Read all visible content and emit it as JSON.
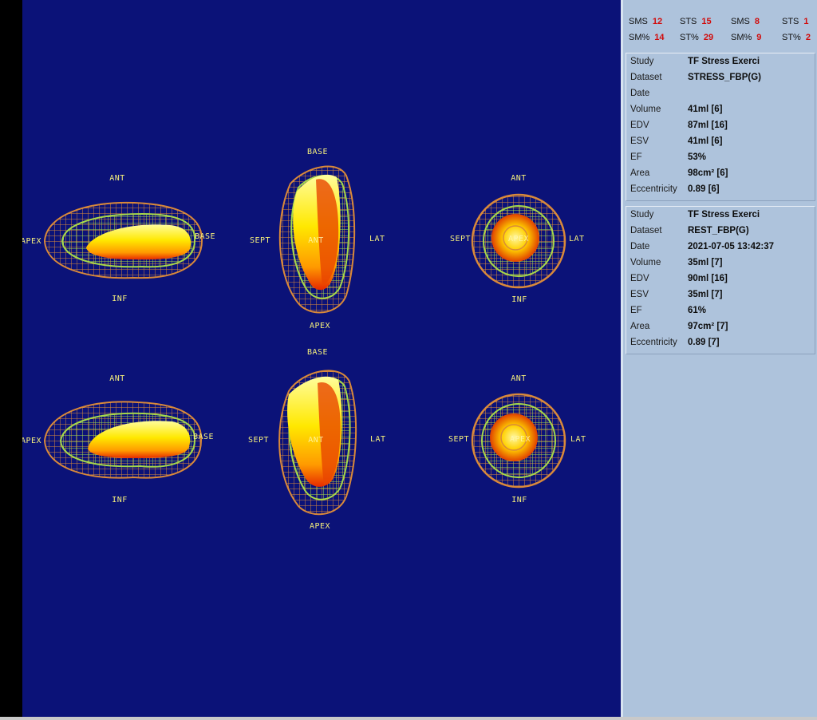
{
  "views": {
    "stress": {
      "horizontal": {
        "ant": "ANT",
        "inf": "INF",
        "apex": "APEX",
        "base": "BASE"
      },
      "vertical": {
        "base": "BASE",
        "sept": "SEPT",
        "ant": "ANT",
        "lat": "LAT",
        "apex": "APEX"
      },
      "short_axis": {
        "ant": "ANT",
        "sept": "SEPT",
        "apex": "APEX",
        "lat": "LAT",
        "inf": "INF"
      }
    },
    "rest": {
      "horizontal": {
        "ant": "ANT",
        "inf": "INF",
        "apex": "APEX",
        "base": "BASE"
      },
      "vertical": {
        "base": "BASE",
        "sept": "SEPT",
        "ant": "ANT",
        "lat": "LAT",
        "apex": "APEX"
      },
      "short_axis": {
        "ant": "ANT",
        "sept": "SEPT",
        "apex": "APEX",
        "lat": "LAT",
        "inf": "INF"
      }
    }
  },
  "scores": [
    {
      "label": "SMS",
      "value": "12"
    },
    {
      "label": "STS",
      "value": "15"
    },
    {
      "label": "SMS",
      "value": "8"
    },
    {
      "label": "STS",
      "value": "1"
    },
    {
      "label": "SM%",
      "value": "14"
    },
    {
      "label": "ST%",
      "value": "29"
    },
    {
      "label": "SM%",
      "value": "9"
    },
    {
      "label": "ST%",
      "value": "2"
    }
  ],
  "stress_info": [
    {
      "key": "Study",
      "value": "TF Stress Exerci"
    },
    {
      "key": "Dataset",
      "value": "STRESS_FBP(G)"
    },
    {
      "key": "Date",
      "value": ""
    },
    {
      "key": "Volume",
      "value": "41ml [6]"
    },
    {
      "key": "EDV",
      "value": "87ml [16]"
    },
    {
      "key": "ESV",
      "value": "41ml [6]"
    },
    {
      "key": "EF",
      "value": "53%"
    },
    {
      "key": "Area",
      "value": "98cm² [6]"
    },
    {
      "key": "Eccentricity",
      "value": "0.89 [6]"
    }
  ],
  "rest_info": [
    {
      "key": "Study",
      "value": "TF Stress Exerci"
    },
    {
      "key": "Dataset",
      "value": "REST_FBP(G)"
    },
    {
      "key": "Date",
      "value": "2021-07-05 13:42:37"
    },
    {
      "key": "Volume",
      "value": "35ml [7]"
    },
    {
      "key": "EDV",
      "value": "90ml [16]"
    },
    {
      "key": "ESV",
      "value": "35ml [7]"
    },
    {
      "key": "EF",
      "value": "61%"
    },
    {
      "key": "Area",
      "value": "97cm² [7]"
    },
    {
      "key": "Eccentricity",
      "value": "0.89 [7]"
    }
  ],
  "colors": {
    "viewport_bg": "#0b1278",
    "panel_bg": "#aec3dc",
    "label_yellow": "#f6f07c",
    "score_red": "#d10b0b",
    "mesh_orange": "#d9893a",
    "mesh_green": "#a6d84a"
  }
}
